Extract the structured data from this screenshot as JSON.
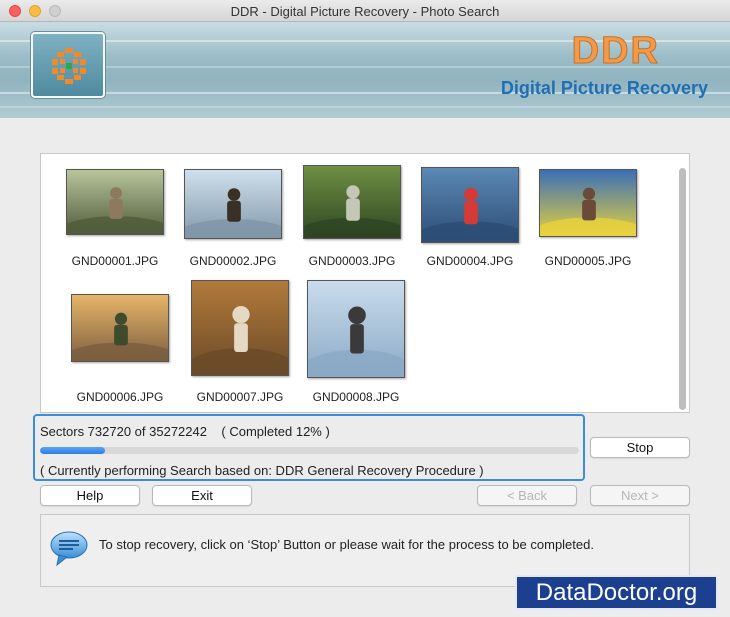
{
  "window": {
    "title": "DDR - Digital Picture Recovery - Photo Search"
  },
  "banner": {
    "brand": "DDR",
    "subtitle": "Digital Picture Recovery",
    "logo_icon": "ddr-logo-icon"
  },
  "thumbnails": [
    {
      "label": "GND00001.JPG",
      "scene": "child-sitting-on-log-forest",
      "colors": [
        "#b8c49a",
        "#4f5b3a",
        "#8d7a5e"
      ]
    },
    {
      "label": "GND00002.JPG",
      "scene": "couple-at-harbor-with-ship",
      "colors": [
        "#cfe0ec",
        "#7f96a8",
        "#3b3026"
      ]
    },
    {
      "label": "GND00003.JPG",
      "scene": "children-on-mossy-rocks",
      "colors": [
        "#6e8f43",
        "#2f4422",
        "#c2c8b5"
      ]
    },
    {
      "label": "GND00004.JPG",
      "scene": "person-kayaking-red-kayak",
      "colors": [
        "#5b88b5",
        "#2c4c74",
        "#d43a36"
      ]
    },
    {
      "label": "GND00005.JPG",
      "scene": "elderly-couple-smiling",
      "colors": [
        "#3a6fb7",
        "#e9d23c",
        "#6b4a3a"
      ]
    },
    {
      "label": "GND00006.JPG",
      "scene": "friends-jumping-at-sunset",
      "colors": [
        "#e7b56a",
        "#7b5e3e",
        "#3e4c2d"
      ]
    },
    {
      "label": "GND00007.JPG",
      "scene": "woman-walking-autumn-forest",
      "colors": [
        "#b27a3a",
        "#6a4a28",
        "#e6d9c3"
      ]
    },
    {
      "label": "GND00008.JPG",
      "scene": "parent-lifting-child-sky",
      "colors": [
        "#c9dcec",
        "#8aa9c4",
        "#3a3a3a"
      ]
    }
  ],
  "progress": {
    "sectors_text": "Sectors 732720 of 35272242",
    "completed_text": "( Completed 12% )",
    "fraction": 0.12,
    "procedure_text": "( Currently performing Search based on: DDR General Recovery Procedure )"
  },
  "buttons": {
    "stop": "Stop",
    "help": "Help",
    "exit": "Exit",
    "back": "< Back",
    "next": "Next >"
  },
  "info": {
    "message": "To stop recovery, click on ‘Stop’ Button or please wait for the process to be completed.",
    "icon": "speech-bubble-icon"
  },
  "watermark": "DataDoctor.org",
  "colors": {
    "accent": "#3b8be0",
    "brand_orange": "#f39a4a",
    "brand_blue": "#1f6fb4"
  }
}
